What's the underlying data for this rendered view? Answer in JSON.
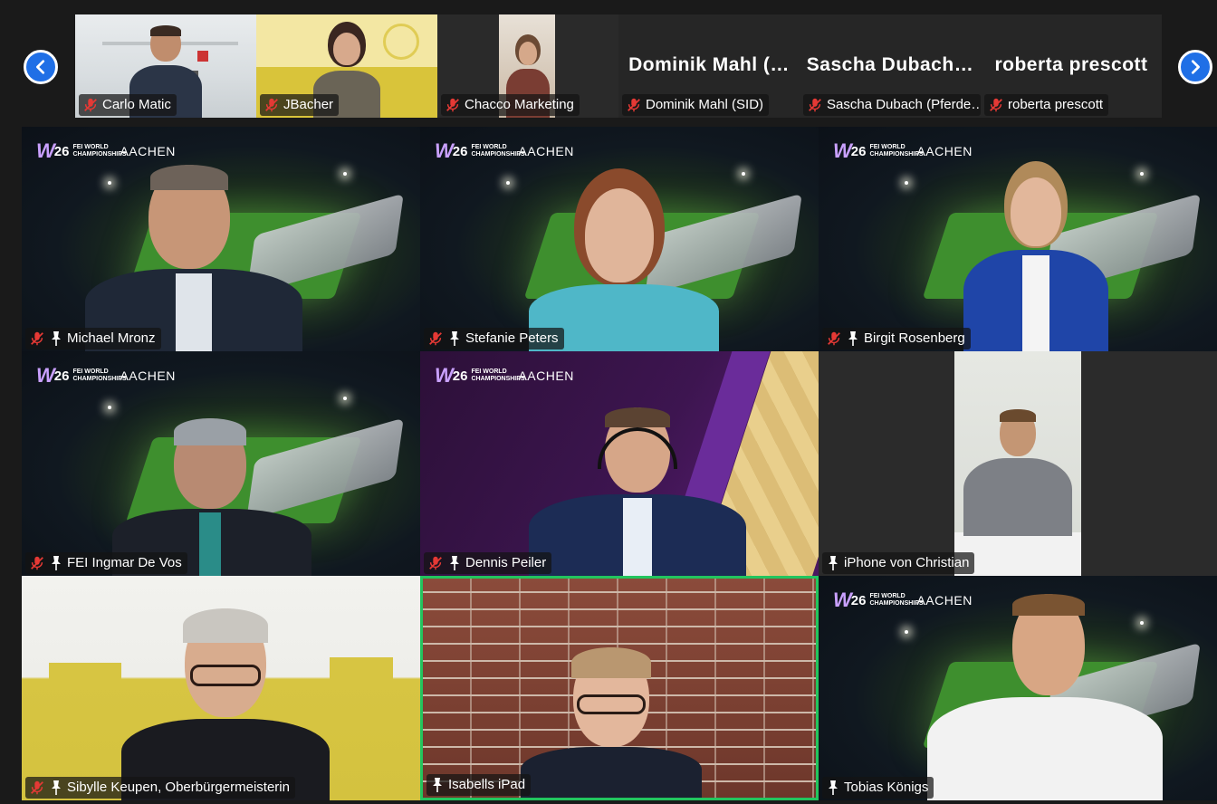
{
  "strip": {
    "prev_label": "previous",
    "next_label": "next",
    "thumbs": [
      {
        "name": "Carlo Matic",
        "muted": true,
        "video": true
      },
      {
        "name": "JBacher",
        "muted": true,
        "video": true
      },
      {
        "name": "Chacco Marketing",
        "muted": true,
        "video": true
      },
      {
        "name": "Dominik Mahl (SID)",
        "display": "Dominik  Mahl  (…",
        "muted": true,
        "video": false
      },
      {
        "name": "Sascha Dubach (Pferde…",
        "display": "Sascha  Dubach…",
        "muted": true,
        "video": false
      },
      {
        "name": "roberta prescott",
        "display": "roberta prescott",
        "muted": true,
        "video": false
      }
    ]
  },
  "brand": {
    "w": "W",
    "num": "26",
    "small": "FEI WORLD CHAMPIONSHIPS",
    "city": "AACHEN"
  },
  "tiles": [
    {
      "name": "Michael Mronz",
      "muted": true,
      "pinned": true
    },
    {
      "name": "Stefanie Peters",
      "muted": true,
      "pinned": true
    },
    {
      "name": "Birgit Rosenberg",
      "muted": true,
      "pinned": true
    },
    {
      "name": "FEI Ingmar De Vos",
      "muted": true,
      "pinned": true
    },
    {
      "name": "Dennis Peiler",
      "muted": true,
      "pinned": true
    },
    {
      "name": "iPhone von Christian",
      "muted": false,
      "pinned": true
    },
    {
      "name": "Sibylle Keupen, Oberbürgermeisterin",
      "muted": true,
      "pinned": true
    },
    {
      "name": "Isabells iPad",
      "muted": false,
      "pinned": true,
      "active_speaker": true
    },
    {
      "name": "Tobias Königs",
      "muted": false,
      "pinned": true
    }
  ],
  "colors": {
    "accent": "#1f6fe6",
    "active_speaker": "#22c55e",
    "muted_icon": "#e53935"
  }
}
